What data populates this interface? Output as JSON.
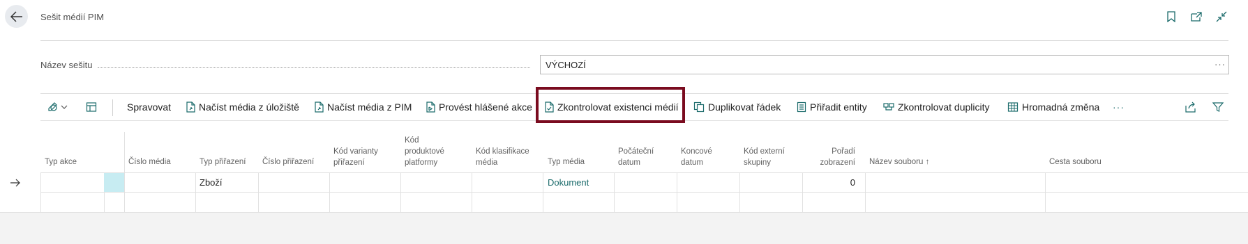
{
  "header": {
    "title": "Sešit médií PIM"
  },
  "batch": {
    "label": "Název sešitu",
    "value": "VÝCHOZÍ",
    "more": "···"
  },
  "toolbar": {
    "manage": "Spravovat",
    "load_storage": "Načíst média z úložiště",
    "load_pim": "Načíst média z PIM",
    "perform_actions": "Provést hlášené akce",
    "check_existence": "Zkontrolovat existenci médií",
    "duplicate_line": "Duplikovat řádek",
    "assign_entities": "Přiřadit entity",
    "check_duplicates": "Zkontrolovat duplicity",
    "bulk_change": "Hromadná změna",
    "more": "···"
  },
  "columns": {
    "action_type": "Typ akce",
    "media_no": "Číslo média",
    "assignment_type": "Typ přiřazení",
    "assignment_no": "Číslo přiřazení",
    "variant_code_1": "Kód varianty",
    "variant_code_2": "přiřazení",
    "platform_1": "Kód",
    "platform_2": "produktové",
    "platform_3": "platformy",
    "classification_1": "Kód klasifikace",
    "classification_2": "média",
    "media_type": "Typ média",
    "start_date_1": "Počáteční",
    "start_date_2": "datum",
    "end_date_1": "Koncové",
    "end_date_2": "datum",
    "ext_group_1": "Kód externí",
    "ext_group_2": "skupiny",
    "order_1": "Pořadí",
    "order_2": "zobrazení",
    "file_name": "Název souboru",
    "sort_arrow": "↑",
    "file_path": "Cesta souboru"
  },
  "rows": [
    {
      "assignment_type": "Zboží",
      "media_type": "Dokument",
      "display_order": "0"
    }
  ],
  "colors": {
    "highlight": "#7a0b1f",
    "link": "#1b6b6b",
    "selected_cell": "#c7ecf2"
  }
}
